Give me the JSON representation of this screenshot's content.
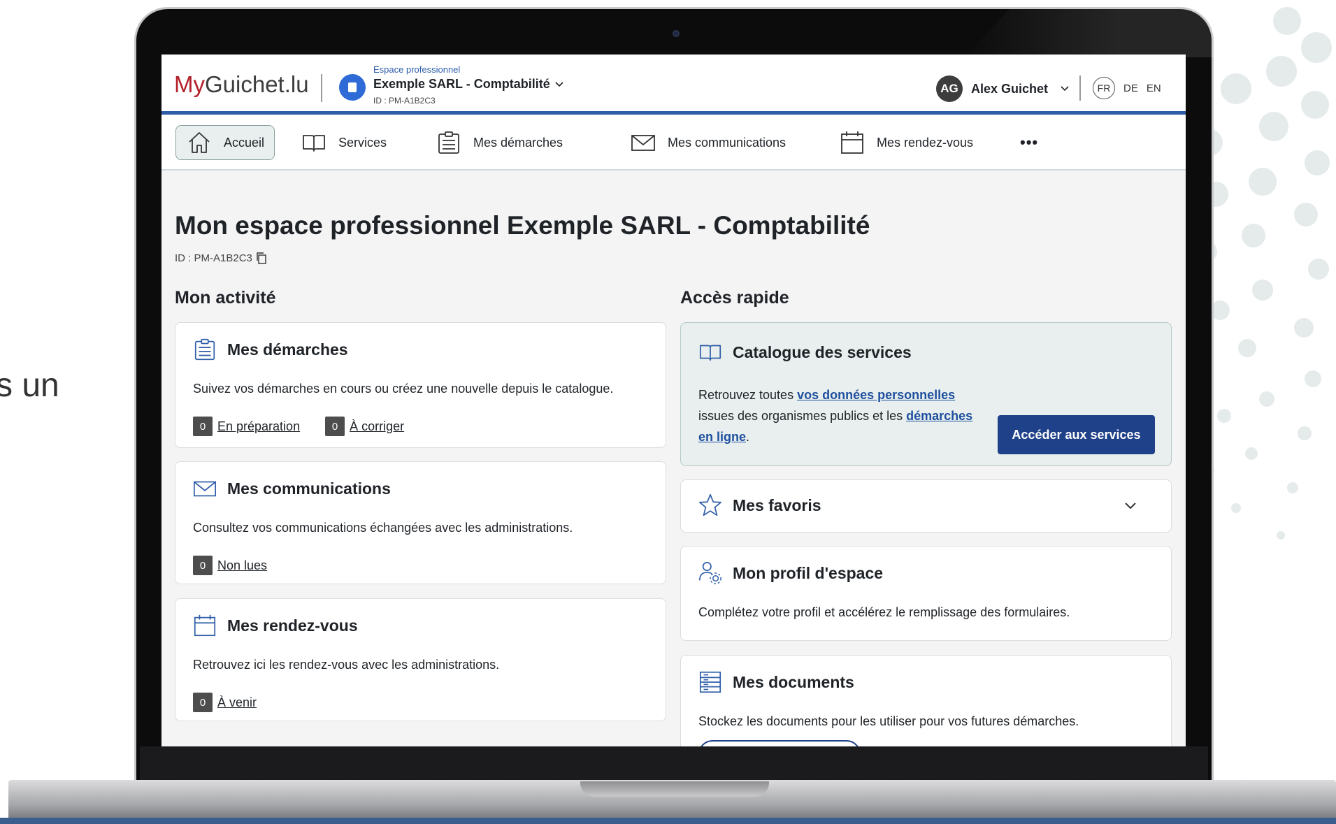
{
  "side_text": "s un",
  "header": {
    "logo_my": "My",
    "logo_rest": "Guichet.lu",
    "space_kicker": "Espace professionnel",
    "space_name": "Exemple SARL - Comptabilité",
    "space_id": "ID : PM-A1B2C3",
    "user_initials": "AG",
    "user_name": "Alex Guichet",
    "langs": [
      "FR",
      "DE",
      "EN"
    ]
  },
  "nav": {
    "home": "Accueil",
    "services": "Services",
    "procedures": "Mes démarches",
    "communications": "Mes communications",
    "appointments": "Mes rendez-vous",
    "more": "•••"
  },
  "main": {
    "title": "Mon espace professionnel Exemple SARL - Comptabilité",
    "id": "ID : PM-A1B2C3",
    "activity_title": "Mon activité",
    "quick_title": "Accès rapide"
  },
  "activity": {
    "procedures": {
      "title": "Mes démarches",
      "desc": "Suivez vos démarches en cours ou créez une nouvelle depuis le catalogue.",
      "links": [
        {
          "count": "0",
          "label": "En préparation"
        },
        {
          "count": "0",
          "label": "À corriger"
        }
      ]
    },
    "communications": {
      "title": "Mes communications",
      "desc": "Consultez vos communications échangées avec les administrations.",
      "links": [
        {
          "count": "0",
          "label": "Non lues"
        }
      ]
    },
    "appointments": {
      "title": "Mes rendez-vous",
      "desc": "Retrouvez ici les rendez-vous avec les administrations.",
      "links": [
        {
          "count": "0",
          "label": "À venir"
        }
      ]
    }
  },
  "quick": {
    "catalogue": {
      "title": "Catalogue des services",
      "text_1": "Retrouvez toutes ",
      "link_1": "vos données personnelles",
      "text_2": " issues des organismes publics et les ",
      "link_2": "démarches en ligne",
      "text_3": ".",
      "button": "Accéder aux services"
    },
    "favorites": {
      "title": "Mes favoris"
    },
    "profile": {
      "title": "Mon profil d'espace",
      "desc": "Complétez votre profil et accélérez le remplissage des formulaires."
    },
    "documents": {
      "title": "Mes documents",
      "desc": "Stockez les documents pour les utiliser pour vos futures démarches."
    }
  },
  "colors": {
    "brand_red": "#b3202a",
    "primary_blue": "#1f4189",
    "header_bar": "#2f5ea8",
    "teal_card": "#e8efee"
  }
}
